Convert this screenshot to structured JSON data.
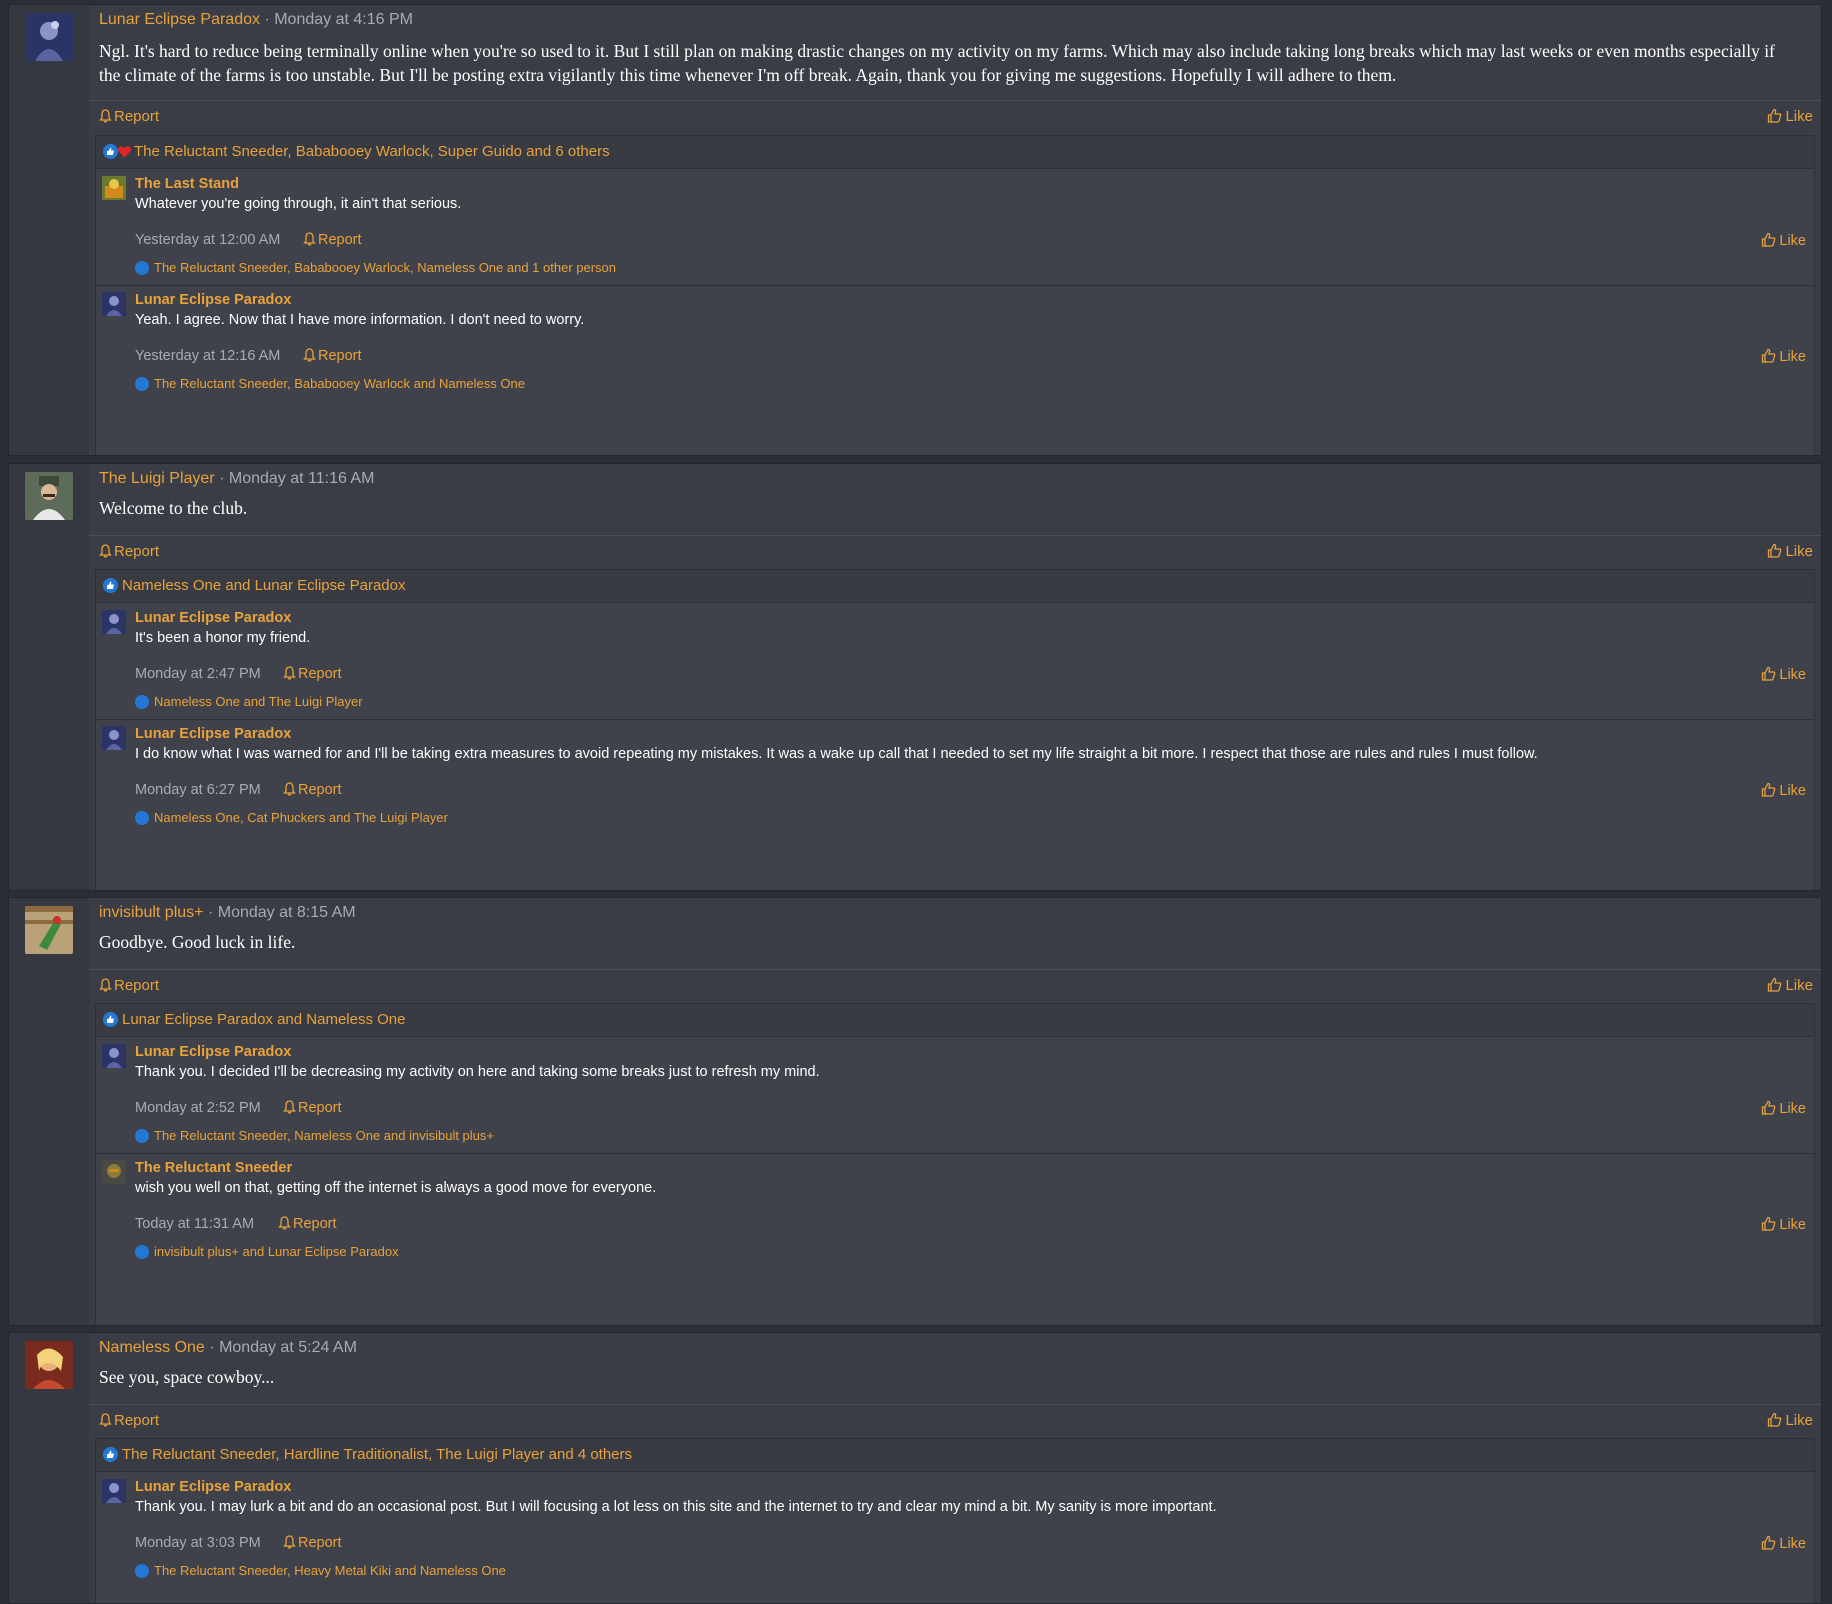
{
  "colors": {
    "accent": "#e9a23b",
    "like_blue": "#2577d6",
    "bg": "#3a3d45"
  },
  "labels": {
    "report": "Report",
    "like": "Like",
    "sep": "·"
  },
  "posts": [
    {
      "author": "Lunar Eclipse Paradox",
      "time": "Monday at 4:16 PM",
      "text": "Ngl. It's hard to reduce being terminally online when you're so used to it. But I still plan on making drastic changes on my activity on my farms. Which may also include taking long breaks which may last weeks or even months especially if the climate of the farms is too unstable. But I'll be posting extra vigilantly this time whenever I'm off break. Again, thank you for giving me suggestions. Hopefully I will adhere to them.",
      "reactions": "The Reluctant Sneeder, Bababooey Warlock, Super Guido and 6 others",
      "comments": [
        {
          "author": "The Last Stand",
          "text": "Whatever you're going through, it ain't that serious.",
          "time": "Yesterday at 12:00 AM",
          "reactions": "The Reluctant Sneeder, Bababooey Warlock, Nameless One and 1 other person"
        },
        {
          "author": "Lunar Eclipse Paradox",
          "text": "Yeah. I agree. Now that I have more information. I don't need to worry.",
          "time": "Yesterday at 12:16 AM",
          "reactions": "The Reluctant Sneeder, Bababooey Warlock and Nameless One"
        }
      ]
    },
    {
      "author": "The Luigi Player",
      "time": "Monday at 11:16 AM",
      "text": "Welcome to the club.",
      "reactions": "Nameless One and Lunar Eclipse Paradox",
      "comments": [
        {
          "author": "Lunar Eclipse Paradox",
          "text": "It's been a honor my friend.",
          "time": "Monday at 2:47 PM",
          "reactions": "Nameless One and The Luigi Player"
        },
        {
          "author": "Lunar Eclipse Paradox",
          "text": "I do know what I was warned for and I'll be taking extra measures to avoid repeating my mistakes. It was a wake up call that I needed to set my life straight a bit more. I respect that those are rules and rules I must follow.",
          "time": "Monday at 6:27 PM",
          "reactions": "Nameless One, Cat Phuckers and The Luigi Player"
        }
      ]
    },
    {
      "author": "invisibult plus+",
      "time": "Monday at 8:15 AM",
      "text": "Goodbye. Good luck in life.",
      "reactions": "Lunar Eclipse Paradox and Nameless One",
      "comments": [
        {
          "author": "Lunar Eclipse Paradox",
          "text": "Thank you. I decided I'll be decreasing my activity on here and taking some breaks just to refresh my mind.",
          "time": "Monday at 2:52 PM",
          "reactions": "The Reluctant Sneeder, Nameless One and invisibult plus+"
        },
        {
          "author": "The Reluctant Sneeder",
          "text": "wish you well on that, getting off the internet is always a good move for everyone.",
          "time": "Today at 11:31 AM",
          "reactions": "invisibult plus+ and Lunar Eclipse Paradox"
        }
      ]
    },
    {
      "author": "Nameless One",
      "time": "Monday at 5:24 AM",
      "text": "See you, space cowboy...",
      "reactions": "The Reluctant Sneeder, Hardline Traditionalist, The Luigi Player and 4 others",
      "comments": [
        {
          "author": "Lunar Eclipse Paradox",
          "text": "Thank you. I may lurk a bit and do an occasional post. But I will focusing a lot less on this site and the internet to try and clear my mind a bit. My sanity is more important.",
          "time": "Monday at 3:03 PM",
          "reactions": "The Reluctant Sneeder, Heavy Metal Kiki and Nameless One"
        }
      ]
    }
  ]
}
